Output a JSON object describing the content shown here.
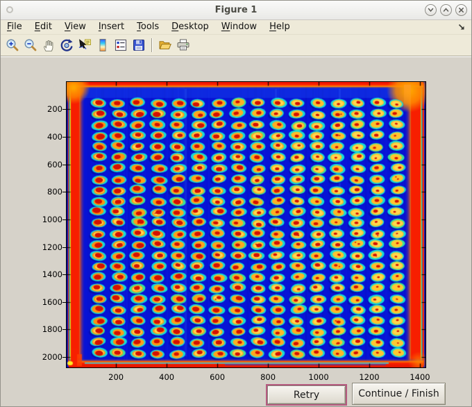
{
  "window": {
    "title": "Figure 1",
    "controls": [
      "minimize",
      "maximize",
      "close"
    ]
  },
  "menu": {
    "items": [
      {
        "label": "File"
      },
      {
        "label": "Edit"
      },
      {
        "label": "View"
      },
      {
        "label": "Insert"
      },
      {
        "label": "Tools"
      },
      {
        "label": "Desktop"
      },
      {
        "label": "Window"
      },
      {
        "label": "Help"
      }
    ],
    "overflow_icon": "menu-overflow-arrow"
  },
  "toolbar": {
    "buttons": [
      {
        "name": "zoom-in"
      },
      {
        "name": "zoom-out"
      },
      {
        "name": "pan"
      },
      {
        "name": "rotate-3d"
      },
      {
        "name": "data-cursor"
      },
      {
        "name": "colorbar"
      },
      {
        "name": "legend"
      },
      {
        "name": "save",
        "sep_after": true
      },
      {
        "name": "open"
      },
      {
        "name": "print"
      }
    ]
  },
  "plot": {
    "type": "heatmap-image",
    "description": "Jet-colormap pseudocolor scan of a 384-well microplate: 16 columns x 24 rows of warm (red/orange/yellow) wells with cyan halos on a blue background, hot red bands along all four plate edges",
    "colormap": "jet",
    "x_ticks": [
      200,
      400,
      600,
      800,
      1000,
      1200,
      1400
    ],
    "y_ticks": [
      200,
      400,
      600,
      800,
      1000,
      1200,
      1400,
      1600,
      1800,
      2000
    ],
    "x_range": [
      5,
      1422
    ],
    "y_range": [
      2,
      2075
    ],
    "wells": {
      "cols": 16,
      "rows": 24,
      "col_start": 131,
      "col_pitch": 78.6,
      "row_start": 156,
      "row_pitch": 79
    },
    "colors": {
      "background": "#0713d6",
      "edge_red": "#f71e00",
      "edge_orange": "#ff8c00",
      "halo_cyan": "#17dbd4",
      "halo_green": "#3ae29a",
      "ring_orange": "#ff9210",
      "ring_yellow": "#ffc830",
      "well_inner_yellow": "#ffd84e",
      "center_red": "#d41000",
      "stripe_yellow": "#ffd800",
      "stripe_cyan": "#00dcdc"
    }
  },
  "actions": {
    "retry_label": "Retry",
    "continue_label": "Continue / Finish"
  }
}
